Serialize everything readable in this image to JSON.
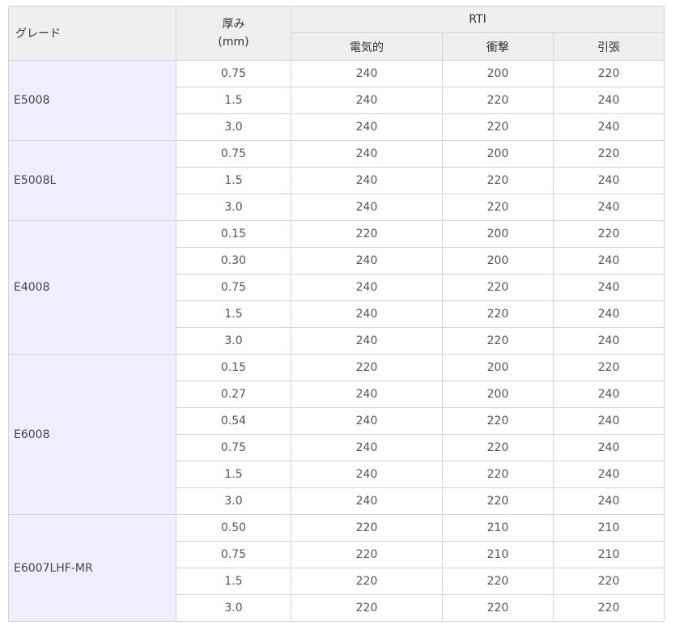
{
  "header": {
    "grade": "グレード",
    "thickness": "厚み",
    "thickness_unit": "(mm)",
    "rti": "RTI",
    "electrical": "電気的",
    "impact": "衝撃",
    "tensile": "引張"
  },
  "groups": [
    {
      "grade": "E5008",
      "rows": [
        {
          "thickness": "0.75",
          "electrical": "240",
          "impact": "200",
          "tensile": "220"
        },
        {
          "thickness": "1.5",
          "electrical": "240",
          "impact": "220",
          "tensile": "240"
        },
        {
          "thickness": "3.0",
          "electrical": "240",
          "impact": "220",
          "tensile": "240"
        }
      ]
    },
    {
      "grade": "E5008L",
      "rows": [
        {
          "thickness": "0.75",
          "electrical": "240",
          "impact": "200",
          "tensile": "220"
        },
        {
          "thickness": "1.5",
          "electrical": "240",
          "impact": "220",
          "tensile": "240"
        },
        {
          "thickness": "3.0",
          "electrical": "240",
          "impact": "220",
          "tensile": "240"
        }
      ]
    },
    {
      "grade": "E4008",
      "rows": [
        {
          "thickness": "0.15",
          "electrical": "220",
          "impact": "200",
          "tensile": "220"
        },
        {
          "thickness": "0.30",
          "electrical": "240",
          "impact": "200",
          "tensile": "240"
        },
        {
          "thickness": "0.75",
          "electrical": "240",
          "impact": "220",
          "tensile": "240"
        },
        {
          "thickness": "1.5",
          "electrical": "240",
          "impact": "220",
          "tensile": "240"
        },
        {
          "thickness": "3.0",
          "electrical": "240",
          "impact": "220",
          "tensile": "240"
        }
      ]
    },
    {
      "grade": "E6008",
      "rows": [
        {
          "thickness": "0.15",
          "electrical": "220",
          "impact": "200",
          "tensile": "220"
        },
        {
          "thickness": "0.27",
          "electrical": "240",
          "impact": "200",
          "tensile": "240"
        },
        {
          "thickness": "0.54",
          "electrical": "240",
          "impact": "220",
          "tensile": "240"
        },
        {
          "thickness": "0.75",
          "electrical": "240",
          "impact": "220",
          "tensile": "240"
        },
        {
          "thickness": "1.5",
          "electrical": "240",
          "impact": "220",
          "tensile": "240"
        },
        {
          "thickness": "3.0",
          "electrical": "240",
          "impact": "220",
          "tensile": "240"
        }
      ]
    },
    {
      "grade": "E6007LHF-MR",
      "rows": [
        {
          "thickness": "0.50",
          "electrical": "220",
          "impact": "210",
          "tensile": "210"
        },
        {
          "thickness": "0.75",
          "electrical": "220",
          "impact": "210",
          "tensile": "210"
        },
        {
          "thickness": "1.5",
          "electrical": "220",
          "impact": "220",
          "tensile": "220"
        },
        {
          "thickness": "3.0",
          "electrical": "220",
          "impact": "220",
          "tensile": "220"
        }
      ]
    }
  ]
}
